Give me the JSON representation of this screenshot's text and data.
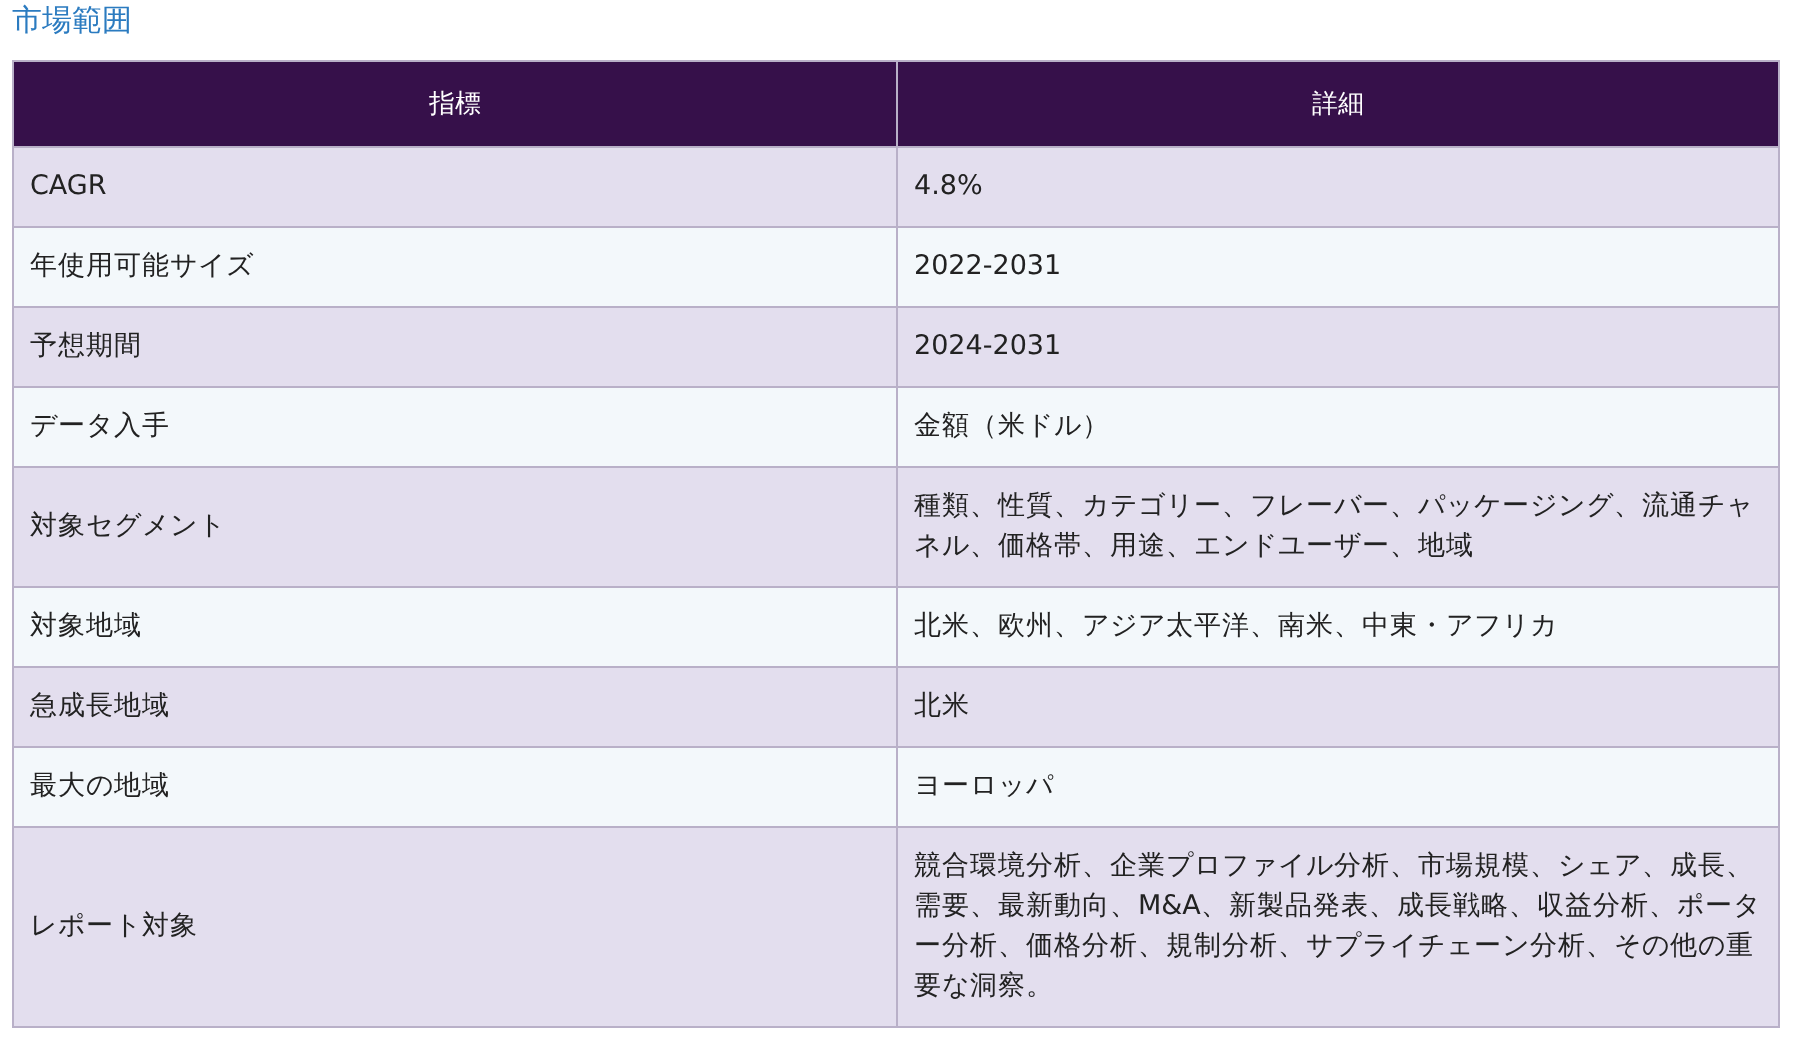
{
  "title": "市場範囲",
  "table": {
    "columns": [
      "指標",
      "詳細"
    ],
    "rows": [
      [
        "CAGR",
        "4.8%"
      ],
      [
        "年使用可能サイズ",
        "2022-2031"
      ],
      [
        "予想期間",
        "2024-2031"
      ],
      [
        "データ入手",
        "金額（米ドル）"
      ],
      [
        "対象セグメント",
        "種類、性質、カテゴリー、フレーバー、パッケージング、流通チャネル、価格帯、用途、エンドユーザー、地域"
      ],
      [
        "対象地域",
        "北米、欧州、アジア太平洋、南米、中東・アフリカ"
      ],
      [
        "急成長地域",
        "北米"
      ],
      [
        "最大の地域",
        "ヨーロッパ"
      ],
      [
        "レポート対象",
        "競合環境分析、企業プロファイル分析、市場規模、シェア、成長、需要、最新動向、M&A、新製品発表、成長戦略、収益分析、ポーター分析、価格分析、規制分析、サプライチェーン分析、その他の重要な洞察。"
      ]
    ]
  }
}
